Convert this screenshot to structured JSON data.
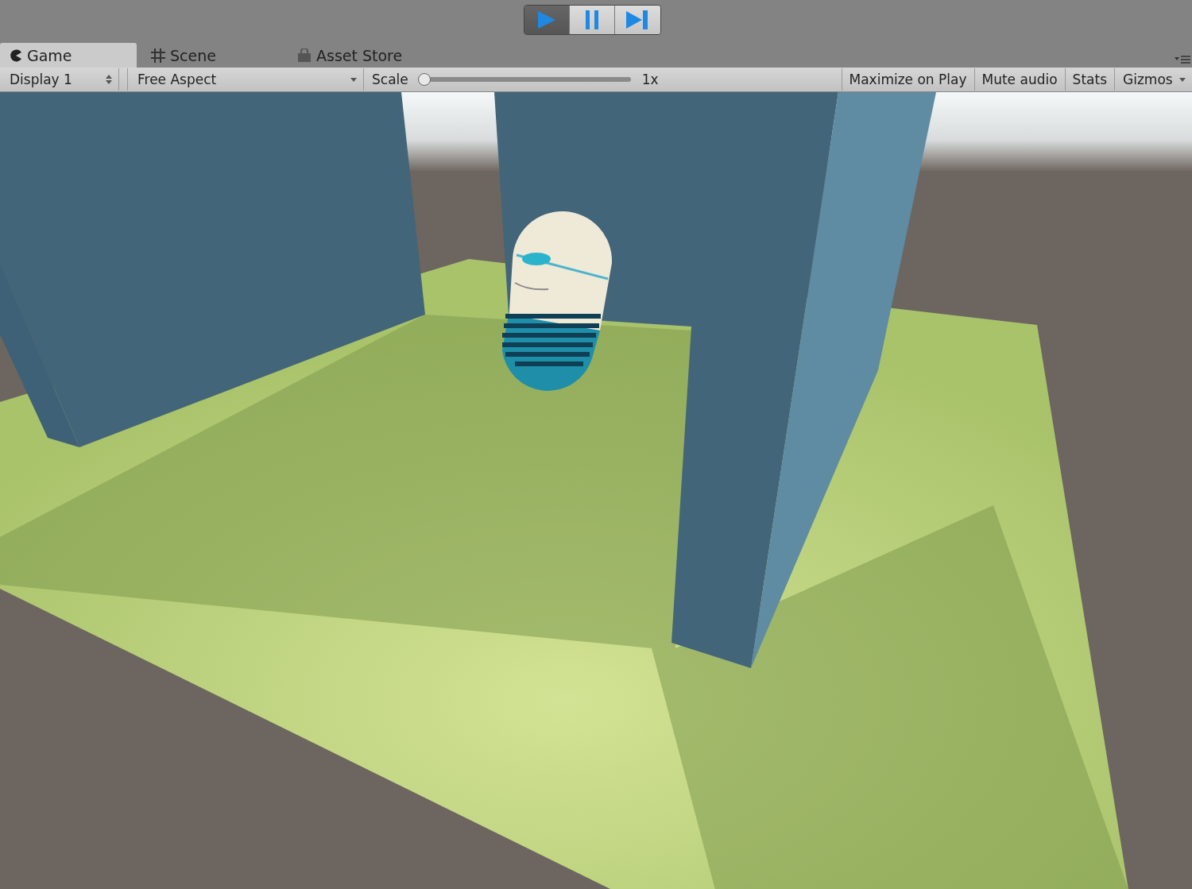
{
  "play_controls": [
    {
      "kind": "play",
      "selected": true
    },
    {
      "kind": "pause",
      "selected": false
    },
    {
      "kind": "step",
      "selected": false
    }
  ],
  "tabs": [
    {
      "kind": "game",
      "label": "Game",
      "selected": true
    },
    {
      "kind": "scene",
      "label": "Scene",
      "selected": false
    },
    {
      "kind": "store",
      "label": "Asset Store",
      "selected": false
    }
  ],
  "toolbar": {
    "display": "Display 1",
    "aspect": "Free Aspect",
    "scale_label": "Scale",
    "scale": {
      "level": 0,
      "reading": "1x"
    },
    "toggles": [
      {
        "label": "Maximize on Play",
        "on": false
      },
      {
        "label": "Mute audio",
        "on": false
      },
      {
        "label": "Stats",
        "on": false
      }
    ],
    "gizmos": "Gizmos"
  }
}
